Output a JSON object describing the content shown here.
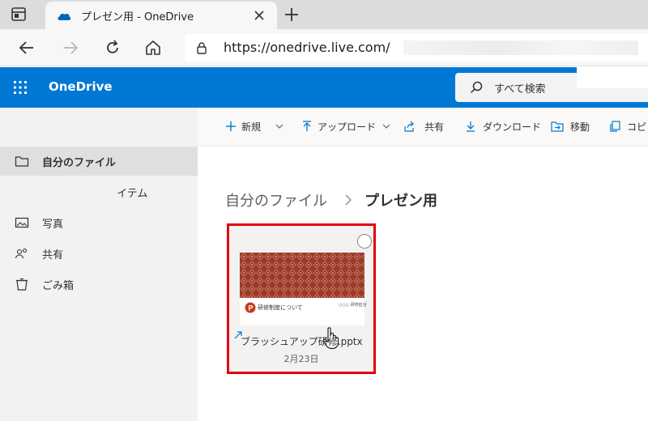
{
  "browser": {
    "tab_title": "プレゼン用 - OneDrive",
    "url": "https://onedrive.live.com/"
  },
  "suite": {
    "brand": "OneDrive",
    "search_placeholder": "すべて検索",
    "accent_color": "#0078d4"
  },
  "sidebar": {
    "items": [
      {
        "label": "自分のファイル",
        "icon": "folder-icon",
        "active": true
      },
      {
        "label": "イテム",
        "icon": "recent-icon",
        "active": false
      },
      {
        "label": "写真",
        "icon": "photo-icon",
        "active": false
      },
      {
        "label": "共有",
        "icon": "people-icon",
        "active": false
      },
      {
        "label": "ごみ箱",
        "icon": "trash-icon",
        "active": false
      }
    ]
  },
  "commands": {
    "new": "新規",
    "upload": "アップロード",
    "share": "共有",
    "download": "ダウンロード",
    "move": "移動",
    "copy": "コピ"
  },
  "breadcrumb": {
    "parent": "自分のファイル",
    "current": "プレゼン用"
  },
  "file": {
    "name": "ブラッシュアップ研修.pptx",
    "date": "2月23日",
    "thumbnail_caption": "研修制度について",
    "thumbnail_note": "○○○\n研修担当",
    "highlight_color": "#e3000f"
  }
}
